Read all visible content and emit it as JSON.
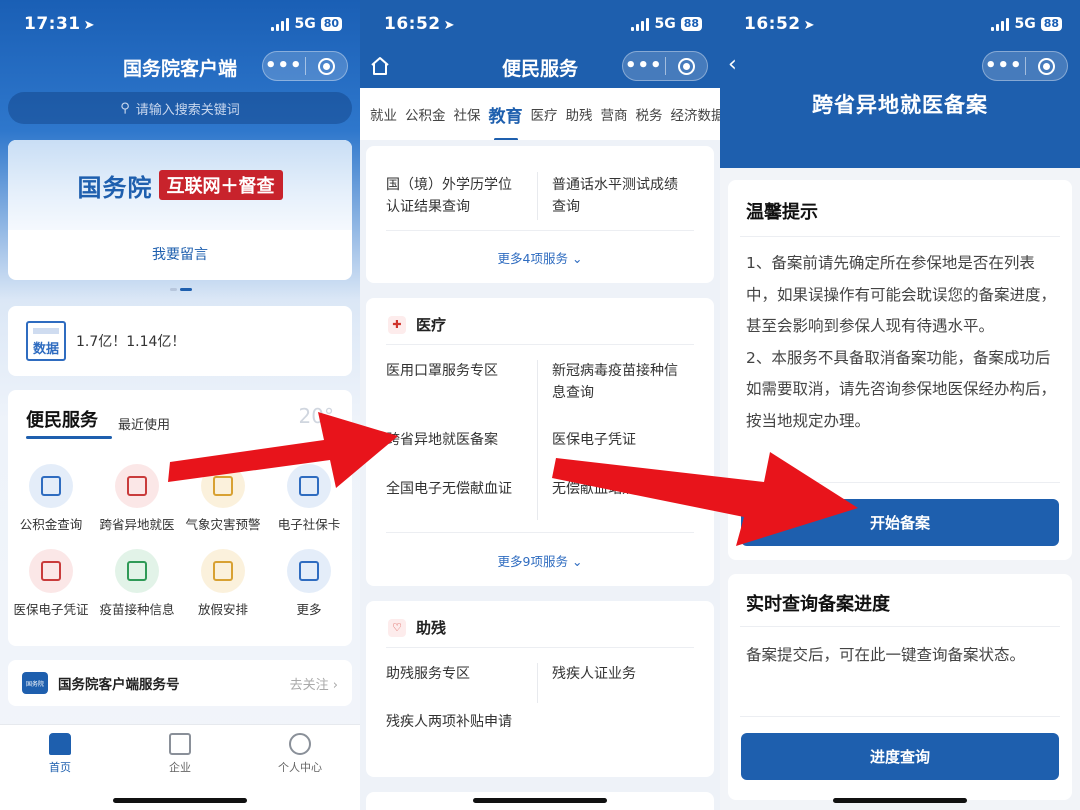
{
  "screen1": {
    "status": {
      "time": "17:31",
      "network": "5G",
      "battery": "80"
    },
    "title": "国务院客户端",
    "search_placeholder": "请输入搜索关键词",
    "banner": {
      "brand": "国务院",
      "tag": "互联网＋督查",
      "action": "我要留言"
    },
    "data_card": {
      "icon_label": "数据",
      "text": "1.7亿！1.14亿！"
    },
    "services": {
      "title": "便民服务",
      "recent": "最近使用",
      "weather": "20°",
      "items": [
        {
          "label": "公积金查询",
          "icon": "fund-icon",
          "color": "#2f6cc0",
          "bg": "#e4edf9"
        },
        {
          "label": "跨省异地就医",
          "icon": "medical-record-icon",
          "color": "#c93b3b",
          "bg": "#fbe7e7"
        },
        {
          "label": "气象灾害预警",
          "icon": "weather-alert-icon",
          "color": "#d8a132",
          "bg": "#fbf1dc"
        },
        {
          "label": "电子社保卡",
          "icon": "social-security-card-icon",
          "color": "#2f6cc0",
          "bg": "#e4edf9"
        },
        {
          "label": "医保电子凭证",
          "icon": "medical-insurance-icon",
          "color": "#c93b3b",
          "bg": "#fbe7e7"
        },
        {
          "label": "疫苗接种信息",
          "icon": "vaccine-icon",
          "color": "#2f9a57",
          "bg": "#e2f3e8"
        },
        {
          "label": "放假安排",
          "icon": "calendar-icon",
          "color": "#d8a132",
          "bg": "#fbf1dc"
        },
        {
          "label": "更多",
          "icon": "more-grid-icon",
          "color": "#2f6cc0",
          "bg": "#e4edf9"
        }
      ]
    },
    "follow": {
      "logo": "国务院",
      "name": "国务院客户端服务号",
      "action": "去关注 ›"
    },
    "tabs": [
      {
        "label": "首页",
        "active": true
      },
      {
        "label": "企业",
        "active": false
      },
      {
        "label": "个人中心",
        "active": false
      }
    ]
  },
  "screen2": {
    "status": {
      "time": "16:52",
      "network": "5G",
      "battery": "88"
    },
    "title": "便民服务",
    "categories": [
      "就业",
      "公积金",
      "社保",
      "教育",
      "医疗",
      "助残",
      "营商",
      "税务",
      "经济数据"
    ],
    "active_category": "教育",
    "education": {
      "items": [
        "国（境）外学历学位认证结果查询",
        "普通话水平测试成绩查询"
      ],
      "more": "更多4项服务 ⌄"
    },
    "medical": {
      "title": "医疗",
      "items": [
        "医用口罩服务专区",
        "新冠病毒疫苗接种信息查询",
        "跨省异地就医备案",
        "医保电子凭证",
        "全国电子无偿献血证",
        "无偿献血站点"
      ],
      "more": "更多9项服务 ⌄"
    },
    "disability": {
      "title": "助残",
      "items": [
        "助残服务专区",
        "残疾人证业务",
        "残疾人两项补贴申请"
      ]
    }
  },
  "screen3": {
    "status": {
      "time": "16:52",
      "network": "5G",
      "battery": "88"
    },
    "title": "跨省异地就医备案",
    "tip": {
      "title": "温馨提示",
      "body": "1、备案前请先确定所在参保地是否在列表中，如果误操作有可能会耽误您的备案进度，甚至会影响到参保人现有待遇水平。\n2、本服务不具备取消备案功能，备案成功后如需要取消，请先咨询参保地医保经办构后，按当地规定办理。",
      "button": "开始备案"
    },
    "query": {
      "title": "实时查询备案进度",
      "body": "备案提交后，可在此一键查询备案状态。",
      "button": "进度查询"
    }
  },
  "colors": {
    "primary": "#1e5fae",
    "arrow": "#e8141b"
  }
}
